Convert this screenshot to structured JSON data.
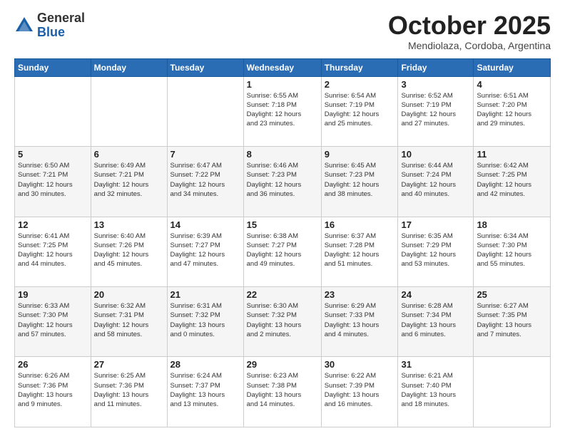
{
  "header": {
    "logo_general": "General",
    "logo_blue": "Blue",
    "month": "October 2025",
    "location": "Mendiolaza, Cordoba, Argentina"
  },
  "weekdays": [
    "Sunday",
    "Monday",
    "Tuesday",
    "Wednesday",
    "Thursday",
    "Friday",
    "Saturday"
  ],
  "weeks": [
    [
      {
        "day": "",
        "info": ""
      },
      {
        "day": "",
        "info": ""
      },
      {
        "day": "",
        "info": ""
      },
      {
        "day": "1",
        "info": "Sunrise: 6:55 AM\nSunset: 7:18 PM\nDaylight: 12 hours\nand 23 minutes."
      },
      {
        "day": "2",
        "info": "Sunrise: 6:54 AM\nSunset: 7:19 PM\nDaylight: 12 hours\nand 25 minutes."
      },
      {
        "day": "3",
        "info": "Sunrise: 6:52 AM\nSunset: 7:19 PM\nDaylight: 12 hours\nand 27 minutes."
      },
      {
        "day": "4",
        "info": "Sunrise: 6:51 AM\nSunset: 7:20 PM\nDaylight: 12 hours\nand 29 minutes."
      }
    ],
    [
      {
        "day": "5",
        "info": "Sunrise: 6:50 AM\nSunset: 7:21 PM\nDaylight: 12 hours\nand 30 minutes."
      },
      {
        "day": "6",
        "info": "Sunrise: 6:49 AM\nSunset: 7:21 PM\nDaylight: 12 hours\nand 32 minutes."
      },
      {
        "day": "7",
        "info": "Sunrise: 6:47 AM\nSunset: 7:22 PM\nDaylight: 12 hours\nand 34 minutes."
      },
      {
        "day": "8",
        "info": "Sunrise: 6:46 AM\nSunset: 7:23 PM\nDaylight: 12 hours\nand 36 minutes."
      },
      {
        "day": "9",
        "info": "Sunrise: 6:45 AM\nSunset: 7:23 PM\nDaylight: 12 hours\nand 38 minutes."
      },
      {
        "day": "10",
        "info": "Sunrise: 6:44 AM\nSunset: 7:24 PM\nDaylight: 12 hours\nand 40 minutes."
      },
      {
        "day": "11",
        "info": "Sunrise: 6:42 AM\nSunset: 7:25 PM\nDaylight: 12 hours\nand 42 minutes."
      }
    ],
    [
      {
        "day": "12",
        "info": "Sunrise: 6:41 AM\nSunset: 7:25 PM\nDaylight: 12 hours\nand 44 minutes."
      },
      {
        "day": "13",
        "info": "Sunrise: 6:40 AM\nSunset: 7:26 PM\nDaylight: 12 hours\nand 45 minutes."
      },
      {
        "day": "14",
        "info": "Sunrise: 6:39 AM\nSunset: 7:27 PM\nDaylight: 12 hours\nand 47 minutes."
      },
      {
        "day": "15",
        "info": "Sunrise: 6:38 AM\nSunset: 7:27 PM\nDaylight: 12 hours\nand 49 minutes."
      },
      {
        "day": "16",
        "info": "Sunrise: 6:37 AM\nSunset: 7:28 PM\nDaylight: 12 hours\nand 51 minutes."
      },
      {
        "day": "17",
        "info": "Sunrise: 6:35 AM\nSunset: 7:29 PM\nDaylight: 12 hours\nand 53 minutes."
      },
      {
        "day": "18",
        "info": "Sunrise: 6:34 AM\nSunset: 7:30 PM\nDaylight: 12 hours\nand 55 minutes."
      }
    ],
    [
      {
        "day": "19",
        "info": "Sunrise: 6:33 AM\nSunset: 7:30 PM\nDaylight: 12 hours\nand 57 minutes."
      },
      {
        "day": "20",
        "info": "Sunrise: 6:32 AM\nSunset: 7:31 PM\nDaylight: 12 hours\nand 58 minutes."
      },
      {
        "day": "21",
        "info": "Sunrise: 6:31 AM\nSunset: 7:32 PM\nDaylight: 13 hours\nand 0 minutes."
      },
      {
        "day": "22",
        "info": "Sunrise: 6:30 AM\nSunset: 7:32 PM\nDaylight: 13 hours\nand 2 minutes."
      },
      {
        "day": "23",
        "info": "Sunrise: 6:29 AM\nSunset: 7:33 PM\nDaylight: 13 hours\nand 4 minutes."
      },
      {
        "day": "24",
        "info": "Sunrise: 6:28 AM\nSunset: 7:34 PM\nDaylight: 13 hours\nand 6 minutes."
      },
      {
        "day": "25",
        "info": "Sunrise: 6:27 AM\nSunset: 7:35 PM\nDaylight: 13 hours\nand 7 minutes."
      }
    ],
    [
      {
        "day": "26",
        "info": "Sunrise: 6:26 AM\nSunset: 7:36 PM\nDaylight: 13 hours\nand 9 minutes."
      },
      {
        "day": "27",
        "info": "Sunrise: 6:25 AM\nSunset: 7:36 PM\nDaylight: 13 hours\nand 11 minutes."
      },
      {
        "day": "28",
        "info": "Sunrise: 6:24 AM\nSunset: 7:37 PM\nDaylight: 13 hours\nand 13 minutes."
      },
      {
        "day": "29",
        "info": "Sunrise: 6:23 AM\nSunset: 7:38 PM\nDaylight: 13 hours\nand 14 minutes."
      },
      {
        "day": "30",
        "info": "Sunrise: 6:22 AM\nSunset: 7:39 PM\nDaylight: 13 hours\nand 16 minutes."
      },
      {
        "day": "31",
        "info": "Sunrise: 6:21 AM\nSunset: 7:40 PM\nDaylight: 13 hours\nand 18 minutes."
      },
      {
        "day": "",
        "info": ""
      }
    ]
  ]
}
